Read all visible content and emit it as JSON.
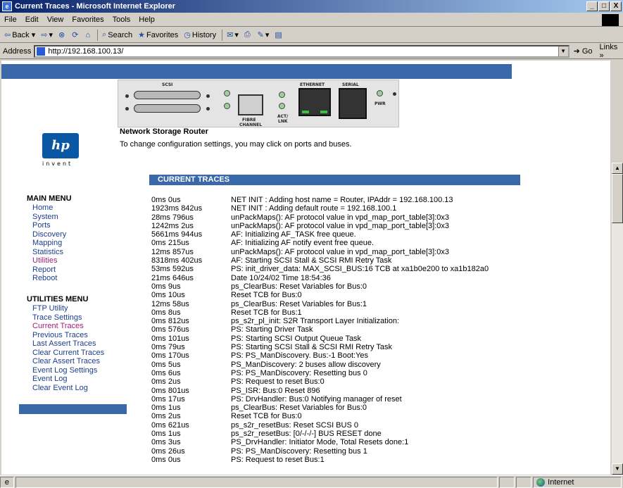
{
  "window": {
    "title": "Current Traces - Microsoft Internet Explorer",
    "btn_min": "_",
    "btn_max": "□",
    "btn_close": "X"
  },
  "menubar": [
    "File",
    "Edit",
    "View",
    "Favorites",
    "Tools",
    "Help"
  ],
  "toolbar": {
    "back": "Back",
    "search": "Search",
    "favorites": "Favorites",
    "history": "History"
  },
  "address": {
    "label": "Address",
    "url": "http://192.168.100.13/",
    "go": "Go",
    "links": "Links"
  },
  "panel": {
    "scsi": "SCSI",
    "ethernet": "ETHERNET",
    "serial": "SERIAL",
    "fibre": "FIBRE",
    "channel": "CHANNEL",
    "act": "ACT/",
    "lnk": "LNK",
    "pwr": "PWR"
  },
  "logo": {
    "mark": "hp",
    "tagline": "invent"
  },
  "header": {
    "title": "Network Storage Router",
    "subtitle": "To change configuration settings, you may click on ports and buses."
  },
  "section_title": "CURRENT TRACES",
  "main_menu": {
    "heading": "MAIN MENU",
    "items": [
      "Home",
      "System",
      "Ports",
      "Discovery",
      "Mapping",
      "Statistics",
      "Utilities",
      "Report",
      "Reboot"
    ],
    "active_index": 6
  },
  "utilities_menu": {
    "heading": "UTILITIES MENU",
    "items": [
      "FTP Utility",
      "Trace Settings",
      "Current Traces",
      "Previous Traces",
      "Last Assert Traces",
      "Clear Current Traces",
      "Clear Assert Traces",
      "Event Log Settings",
      "Event Log",
      "Clear Event Log"
    ],
    "active_index": 2
  },
  "traces": [
    {
      "t": "0ms 0us",
      "m": "NET INIT : Adding host name = Router, IPAddr = 192.168.100.13"
    },
    {
      "t": "1923ms 842us",
      "m": "NET INIT : Adding default route = 192.168.100.1"
    },
    {
      "t": "28ms 796us",
      "m": "unPackMaps(): AF protocol value in vpd_map_port_table[3]:0x3"
    },
    {
      "t": "1242ms 2us",
      "m": "unPackMaps(): AF protocol value in vpd_map_port_table[3]:0x3"
    },
    {
      "t": "5661ms 944us",
      "m": "AF: Initializing AF_TASK free queue."
    },
    {
      "t": "0ms 215us",
      "m": "AF: Initializing AF notify event free queue."
    },
    {
      "t": "12ms 857us",
      "m": "unPackMaps(): AF protocol value in vpd_map_port_table[3]:0x3"
    },
    {
      "t": "8318ms 402us",
      "m": "AF: Starting SCSI Stall & SCSI RMI Retry Task"
    },
    {
      "t": "53ms 592us",
      "m": "PS: init_driver_data: MAX_SCSI_BUS:16 TCB at xa1b0e200 to xa1b182a0"
    },
    {
      "t": "21ms 646us",
      "m": "Date 10/24/02 Time 18:54:36"
    },
    {
      "t": "0ms 9us",
      "m": "ps_ClearBus: Reset Variables for Bus:0"
    },
    {
      "t": "0ms 10us",
      "m": "Reset TCB for Bus:0"
    },
    {
      "t": "12ms 58us",
      "m": "ps_ClearBus: Reset Variables for Bus:1"
    },
    {
      "t": "0ms 8us",
      "m": "Reset TCB for Bus:1"
    },
    {
      "t": "0ms 812us",
      "m": "ps_s2r_pl_init: S2R Transport Layer Initialization:"
    },
    {
      "t": "0ms 576us",
      "m": "PS: Starting Driver Task"
    },
    {
      "t": "0ms 101us",
      "m": "PS: Starting SCSI Output Queue Task"
    },
    {
      "t": "0ms 79us",
      "m": "PS: Starting SCSI Stall & SCSI RMI Retry Task"
    },
    {
      "t": "0ms 170us",
      "m": "PS: PS_ManDiscovery. Bus:-1 Boot:Yes"
    },
    {
      "t": "0ms 5us",
      "m": "PS_ManDiscovery: 2 buses allow discovery"
    },
    {
      "t": "0ms 6us",
      "m": "PS: PS_ManDiscovery: Resetting bus 0"
    },
    {
      "t": "0ms 2us",
      "m": "PS: Request to reset Bus:0"
    },
    {
      "t": "0ms 801us",
      "m": "PS_ISR: Bus:0 Reset 896"
    },
    {
      "t": "0ms 17us",
      "m": "PS: DrvHandler: Bus:0 Notifying manager of reset"
    },
    {
      "t": "0ms 1us",
      "m": "ps_ClearBus: Reset Variables for Bus:0"
    },
    {
      "t": "0ms 2us",
      "m": "Reset TCB for Bus:0"
    },
    {
      "t": "0ms 621us",
      "m": "ps_s2r_resetBus: Reset SCSI BUS 0"
    },
    {
      "t": "0ms 1us",
      "m": "ps_s2r_resetBus: [0/-/-/-] BUS RESET done"
    },
    {
      "t": "0ms 3us",
      "m": "PS_DrvHandler: Initiator Mode, Total Resets done:1"
    },
    {
      "t": "0ms 26us",
      "m": "PS: PS_ManDiscovery: Resetting bus 1"
    },
    {
      "t": "0ms 0us",
      "m": "PS: Request to reset Bus:1"
    }
  ],
  "statusbar": {
    "zone": "Internet"
  },
  "colors": {
    "accent_bar": "#3a68a8",
    "link": "#1c3e8c",
    "visited": "#a0207a"
  }
}
